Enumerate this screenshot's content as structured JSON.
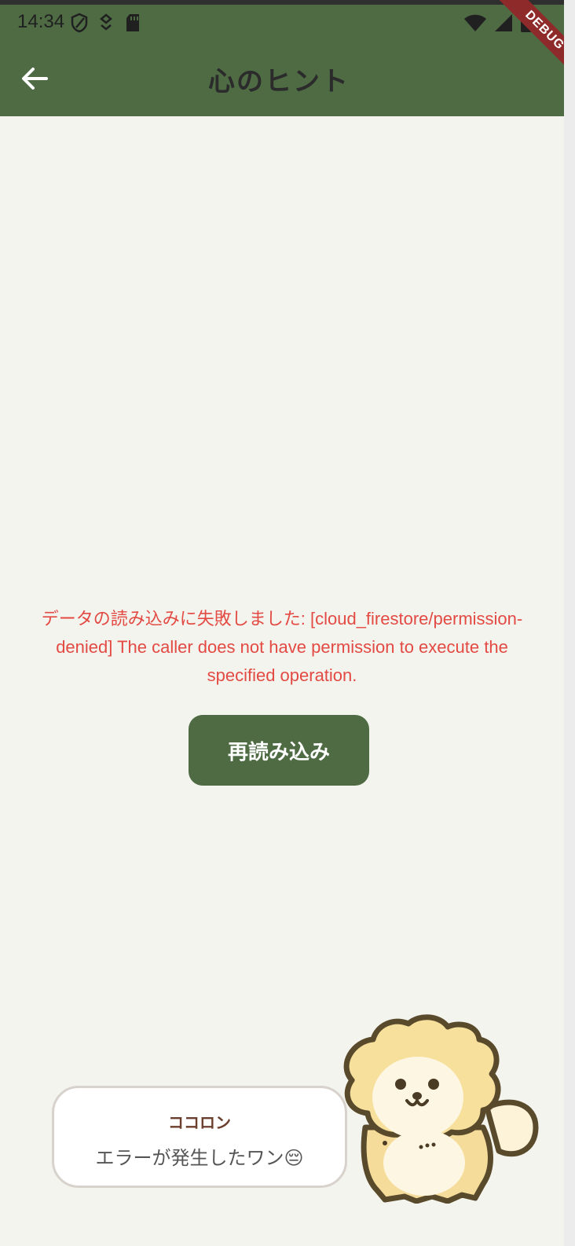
{
  "status_bar": {
    "time": "14:34",
    "icons_left": [
      "shield-icon",
      "usb-debug-icon",
      "sd-card-icon"
    ],
    "icons_right": [
      "wifi-icon",
      "signal-icon",
      "battery-icon"
    ]
  },
  "app_bar": {
    "title": "心のヒント",
    "back_icon": "arrow-left-icon",
    "background_color": "#4e6b44"
  },
  "debug_banner": {
    "label": "DEBUG",
    "color": "#8e2a2a"
  },
  "error": {
    "message_line1": "データの読み込みに失敗しました: [cloud_firestore/permission-",
    "message_line2": "denied] The caller does not have permission to execute the",
    "message_line3": "specified operation.",
    "color": "#e24a43"
  },
  "reload_button": {
    "label": "再読み込み"
  },
  "mascot": {
    "name": "ココロン",
    "message": "エラーが発生したワン😔"
  }
}
